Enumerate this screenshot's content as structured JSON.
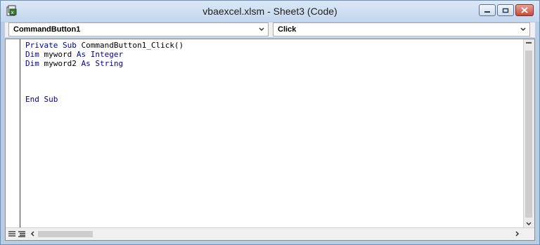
{
  "window": {
    "title": "vbaexcel.xlsm - Sheet3 (Code)",
    "icon": "excel-vba-icon"
  },
  "object_dropdown": {
    "value": "CommandButton1"
  },
  "procedure_dropdown": {
    "value": "Click"
  },
  "code": {
    "lines": [
      {
        "parts": [
          {
            "text": "Private Sub ",
            "kind": "keyword"
          },
          {
            "text": "CommandButton1_Click()",
            "kind": "text"
          }
        ]
      },
      {
        "parts": [
          {
            "text": "Dim ",
            "kind": "keyword"
          },
          {
            "text": "myword ",
            "kind": "text"
          },
          {
            "text": "As Integer",
            "kind": "keyword"
          }
        ]
      },
      {
        "parts": [
          {
            "text": "Dim ",
            "kind": "keyword"
          },
          {
            "text": "myword2 ",
            "kind": "text"
          },
          {
            "text": "As String",
            "kind": "keyword"
          }
        ]
      },
      {
        "parts": []
      },
      {
        "parts": []
      },
      {
        "parts": []
      },
      {
        "parts": [
          {
            "text": "End Sub",
            "kind": "keyword"
          }
        ]
      }
    ]
  },
  "colors": {
    "keyword": "#000099",
    "text": "#000000",
    "titlebar": "#c4d7ee"
  },
  "view_buttons": [
    "procedure-view-icon",
    "full-module-view-icon"
  ]
}
